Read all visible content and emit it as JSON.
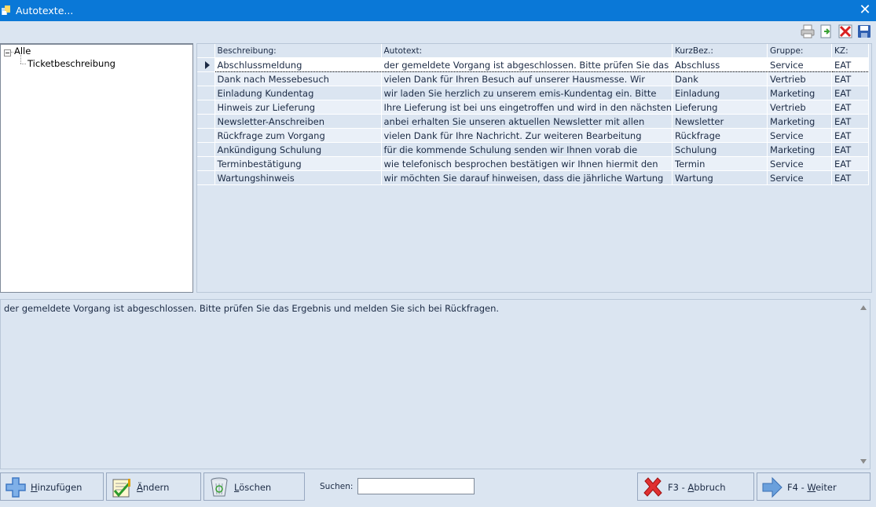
{
  "window": {
    "title": "Autotexte..."
  },
  "tree": {
    "root": "Alle",
    "child": "Ticketbeschreibung"
  },
  "grid": {
    "columns": [
      "Beschreibung:",
      "Autotext:",
      "KurzBez.:",
      "Gruppe:",
      "KZ:"
    ],
    "rows": [
      [
        "Abschlussmeldung",
        "der gemeldete Vorgang ist abgeschlossen. Bitte prüfen Sie das",
        "Abschluss",
        "Service",
        "EAT"
      ],
      [
        "Dank nach Messebesuch",
        "vielen Dank für Ihren Besuch auf unserer Hausmesse. Wir",
        "Dank",
        "Vertrieb",
        "EAT"
      ],
      [
        "Einladung Kundentag",
        "wir laden Sie herzlich zu unserem emis-Kundentag ein. Bitte",
        "Einladung",
        "Marketing",
        "EAT"
      ],
      [
        "Hinweis zur Lieferung",
        "Ihre Lieferung ist bei uns eingetroffen und wird in den nächsten",
        "Lieferung",
        "Vertrieb",
        "EAT"
      ],
      [
        "Newsletter-Anschreiben",
        "anbei erhalten Sie unseren aktuellen Newsletter mit allen",
        "Newsletter",
        "Marketing",
        "EAT"
      ],
      [
        "Rückfrage zum Vorgang",
        "vielen Dank für Ihre Nachricht. Zur weiteren Bearbeitung",
        "Rückfrage",
        "Service",
        "EAT"
      ],
      [
        "Ankündigung Schulung",
        "für die kommende Schulung senden wir Ihnen vorab die",
        "Schulung",
        "Marketing",
        "EAT"
      ],
      [
        "Terminbestätigung",
        "wie telefonisch besprochen bestätigen wir Ihnen hiermit den",
        "Termin",
        "Service",
        "EAT"
      ],
      [
        "Wartungshinweis",
        "wir möchten Sie darauf hinweisen, dass die jährliche Wartung",
        "Wartung",
        "Service",
        "EAT"
      ]
    ]
  },
  "memo": {
    "text": "der gemeldete Vorgang ist abgeschlossen. Bitte prüfen Sie das Ergebnis und melden Sie sich bei Rückfragen."
  },
  "buttons": {
    "add": {
      "u": "H",
      "rest": "inzufügen"
    },
    "edit": {
      "u": "Ä",
      "rest": "ndern"
    },
    "delete": {
      "u": "L",
      "rest": "öschen"
    },
    "cancel": {
      "pre": "F3 - ",
      "u": "A",
      "rest": "bbruch"
    },
    "next": {
      "pre": "F4 - ",
      "u": "W",
      "rest": "eiter"
    }
  },
  "search": {
    "label": "Suchen:",
    "value": ""
  },
  "colors": {
    "title_bar": "#0a78d7",
    "background": "#dbe5f1",
    "row_alt": "#eaf0f8"
  },
  "icons": [
    "app-icon",
    "close-icon",
    "print-icon",
    "export-icon",
    "delete-x-icon",
    "save-disk-icon",
    "add-plus-icon",
    "edit-notepad-icon",
    "recycle-bin-icon",
    "cancel-x-icon",
    "next-arrow-icon"
  ]
}
